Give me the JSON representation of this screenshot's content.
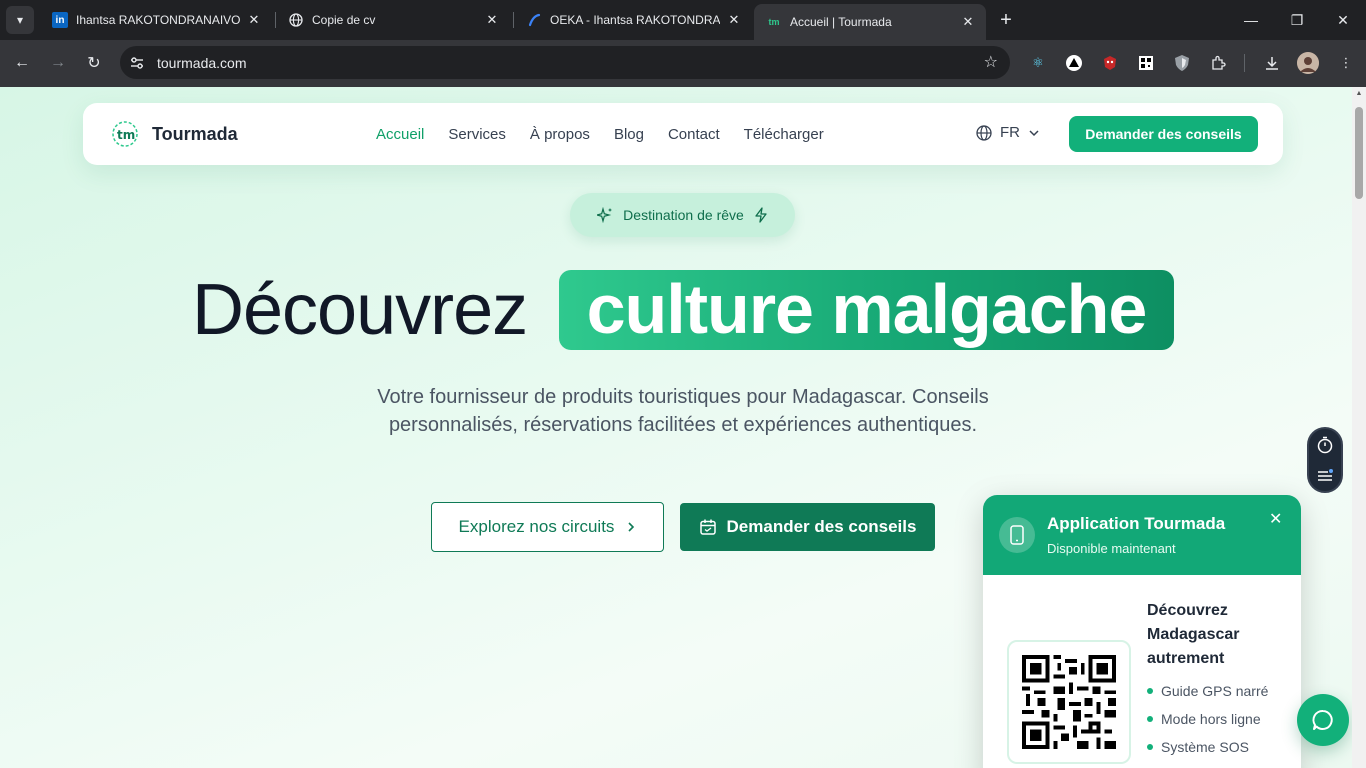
{
  "browser": {
    "tabs": [
      {
        "title": "Ihantsa RAKOTONDRANAIVO | L",
        "favicon": "linkedin-icon"
      },
      {
        "title": "Copie de cv",
        "favicon": "globe-icon"
      },
      {
        "title": "OEKA - Ihantsa RAKOTONDRAN",
        "favicon": "oeka-icon"
      },
      {
        "title": "Accueil | Tourmada",
        "favicon": "tourmada-icon"
      }
    ],
    "url": "tourmada.com"
  },
  "site": {
    "brand": "Tourmada",
    "nav": [
      "Accueil",
      "Services",
      "À propos",
      "Blog",
      "Contact",
      "Télécharger"
    ],
    "active_nav": "Accueil",
    "language": "FR",
    "top_cta": "Demander des conseils",
    "accent": "#12b07a"
  },
  "hero": {
    "pill": "Destination de rêve",
    "title_plain": "Découvrez",
    "title_highlight": "culture malgache",
    "subtitle_line1": "Votre fournisseur de produits touristiques pour Madagascar. Conseils",
    "subtitle_line2": "personnalisés, réservations facilitées et expériences authentiques.",
    "btn_explore": "Explorez nos circuits",
    "btn_advice": "Demander des conseils"
  },
  "app_popup": {
    "title": "Application Tourmada",
    "subtitle": "Disponible maintenant",
    "body_title": "Découvrez Madagascar autrement",
    "features": [
      "Guide GPS narré",
      "Mode hors ligne",
      "Système SOS"
    ]
  }
}
